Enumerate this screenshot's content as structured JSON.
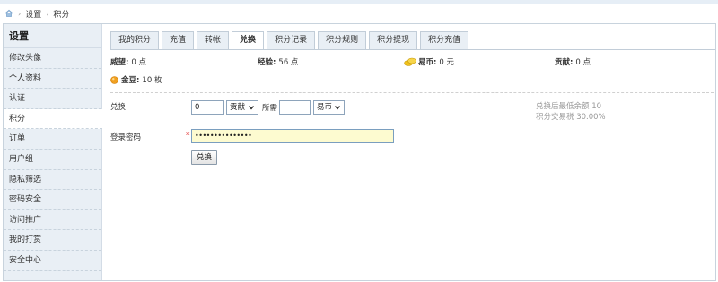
{
  "breadcrumb": {
    "items": [
      "设置",
      "积分"
    ]
  },
  "sidebar": {
    "title": "设置",
    "items": [
      {
        "label": "修改头像"
      },
      {
        "label": "个人资料"
      },
      {
        "label": "认证"
      },
      {
        "label": "积分"
      },
      {
        "label": "订单"
      },
      {
        "label": "用户组"
      },
      {
        "label": "隐私筛选"
      },
      {
        "label": "密码安全"
      },
      {
        "label": "访问推广"
      },
      {
        "label": "我的打赏"
      },
      {
        "label": "安全中心"
      }
    ],
    "active_index": 3
  },
  "tabs": {
    "items": [
      "我的积分",
      "充值",
      "转帐",
      "兑换",
      "积分记录",
      "积分规则",
      "积分提现",
      "积分充值"
    ],
    "active_index": 3
  },
  "stats": {
    "prestige": {
      "label": "威望:",
      "value": "0 点"
    },
    "experience": {
      "label": "经验:",
      "value": "56 点"
    },
    "coins": {
      "label": "易币:",
      "value": "0 元"
    },
    "contribution": {
      "label": "贡献:",
      "value": "0 点"
    },
    "beans": {
      "label": "金豆:",
      "value": "10 枚"
    }
  },
  "exchange": {
    "label": "兑换",
    "amount_value": "0",
    "from_select": "贡献",
    "required_label": "所需",
    "required_value": "",
    "to_select": "易币",
    "hint_line1": "兑换后最低余额 10",
    "hint_line2": "积分交易税 30.00%",
    "password_label": "登录密码",
    "required_mark": "*",
    "password_value": "•••••••••••••••",
    "submit_label": "兑换"
  },
  "colors": {
    "accent": "#c2cdd8",
    "sidebar_bg": "#e9eff5",
    "password_bg": "#fdfbd0",
    "required": "#e02020"
  }
}
